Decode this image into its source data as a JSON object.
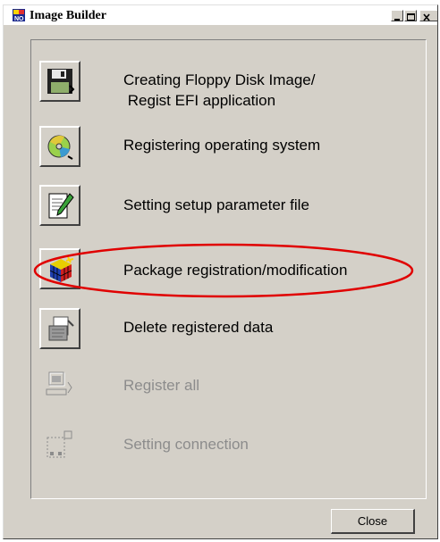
{
  "window": {
    "title": "Image Builder",
    "app_icon": "image-builder-icon"
  },
  "items": [
    {
      "label_line1": "Creating Floppy Disk Image/",
      "label_line2": " Regist EFI application",
      "icon": "floppy-disk-icon",
      "enabled": true
    },
    {
      "label": "Registering operating system",
      "icon": "cd-disc-icon",
      "enabled": true
    },
    {
      "label": "Setting setup parameter file",
      "icon": "document-pen-icon",
      "enabled": true
    },
    {
      "label": "Package registration/modification",
      "icon": "package-cube-icon",
      "enabled": true,
      "highlighted": true
    },
    {
      "label": "Delete registered data",
      "icon": "delete-data-icon",
      "enabled": true
    },
    {
      "label": "Register all",
      "icon": "register-all-icon",
      "enabled": false
    },
    {
      "label": "Setting connection",
      "icon": "connection-icon",
      "enabled": false
    }
  ],
  "footer": {
    "close_label": "Close"
  },
  "colors": {
    "window_bg": "#d4d0c8",
    "highlight_ellipse": "#e00000",
    "disabled_text": "#8c8c8c"
  }
}
